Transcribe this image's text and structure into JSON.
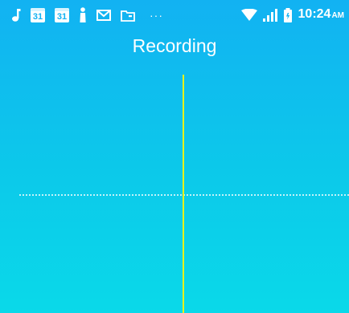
{
  "status_bar": {
    "icons_left": [
      "music-note-icon",
      "calendar-icon",
      "calendar-icon",
      "figure-icon",
      "mail-icon",
      "tray-icon",
      "more-dots-icon"
    ],
    "calendar_day_1": "31",
    "calendar_day_2": "31",
    "more_dots": "···",
    "icons_right": [
      "wifi-icon",
      "signal-icon",
      "battery-icon"
    ],
    "time": "10:24",
    "ampm": "AM"
  },
  "header": {
    "title": "Recording"
  },
  "colors": {
    "background_top": "#12b2f2",
    "background_bottom": "#0ad9e9",
    "playhead": "#e6f21c",
    "text": "#ffffff"
  }
}
